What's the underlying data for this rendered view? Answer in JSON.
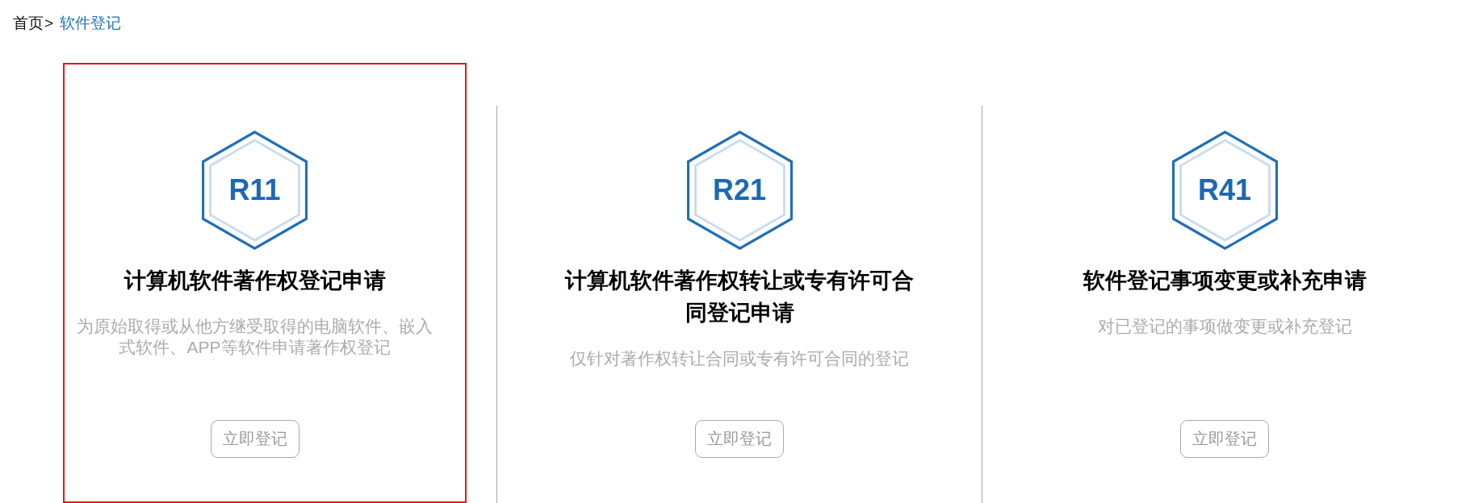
{
  "breadcrumb": {
    "separator": ">",
    "items": [
      {
        "label": "首页",
        "current": false
      },
      {
        "label": "软件登记",
        "current": true
      }
    ]
  },
  "cards": [
    {
      "code": "R11",
      "title": "计算机软件著作权登记申请",
      "description": "为原始取得或从他方继受取得的电脑软件、嵌入式软件、APP等软件申请著作权登记",
      "button": "立即登记",
      "selected": true
    },
    {
      "code": "R21",
      "title": "计算机软件著作权转让或专有许可合同登记申请",
      "description": "仅针对著作权转让合同或专有许可合同的登记",
      "button": "立即登记",
      "selected": false
    },
    {
      "code": "R41",
      "title": "软件登记事项变更或补充申请",
      "description": "对已登记的事项做变更或补充登记",
      "button": "立即登记",
      "selected": false
    }
  ]
}
